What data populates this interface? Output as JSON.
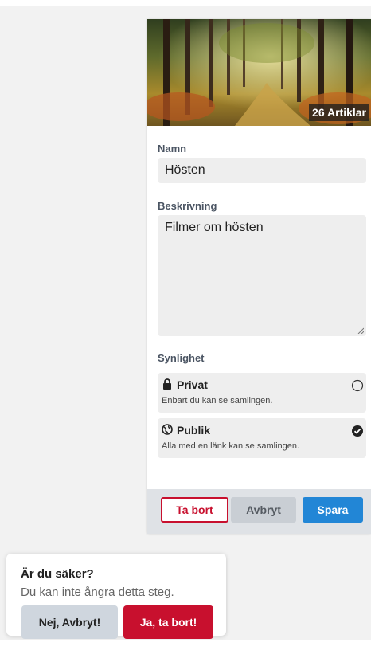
{
  "collection": {
    "article_count_label": "26 Artiklar",
    "name_label": "Namn",
    "name_value": "Hösten",
    "description_label": "Beskrivning",
    "description_value": "Filmer om hösten",
    "visibility_label": "Synlighet",
    "options": [
      {
        "title": "Privat",
        "description": "Enbart du kan se samlingen.",
        "icon": "lock-icon",
        "selected": false
      },
      {
        "title": "Publik",
        "description": "Alla med en länk kan se samlingen.",
        "icon": "globe-icon",
        "selected": true
      }
    ]
  },
  "footer": {
    "delete_label": "Ta bort",
    "cancel_label": "Avbryt",
    "save_label": "Spara"
  },
  "confirm": {
    "title": "Är du säker?",
    "message": "Du kan inte ångra detta steg.",
    "no_label": "Nej, Avbryt!",
    "yes_label": "Ja, ta bort!"
  },
  "colors": {
    "danger": "#c8102e",
    "primary": "#2286d6",
    "muted_button": "#c9ced4"
  }
}
